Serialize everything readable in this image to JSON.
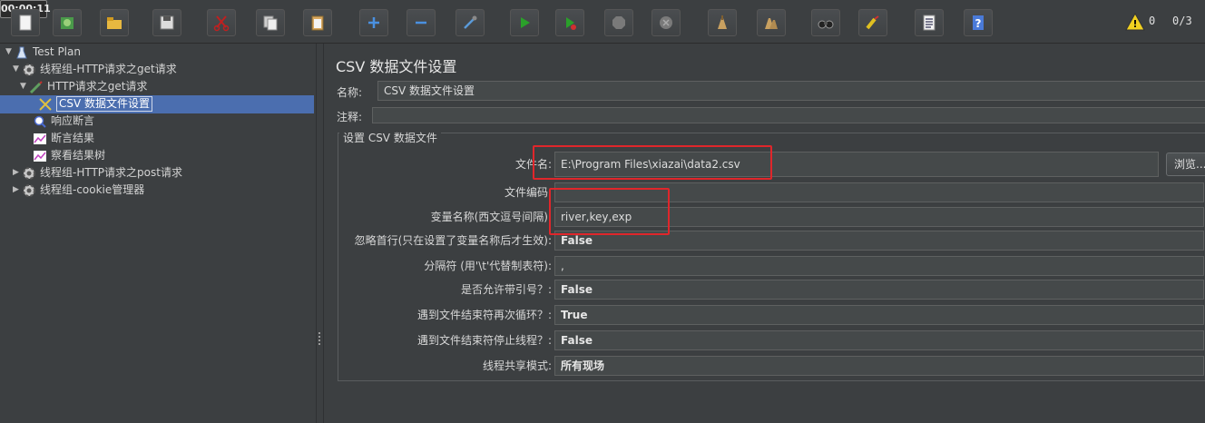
{
  "toolbar": {
    "buttons": [
      {
        "name": "new-icon"
      },
      {
        "name": "templates-icon"
      },
      {
        "name": "open-icon"
      },
      {
        "name": "save-icon"
      },
      {
        "name": "cut-icon"
      },
      {
        "name": "copy-icon"
      },
      {
        "name": "paste-icon"
      },
      {
        "name": "expand-icon"
      },
      {
        "name": "collapse-icon"
      },
      {
        "name": "toggle-icon"
      },
      {
        "name": "start-icon"
      },
      {
        "name": "start-no-pause-icon"
      },
      {
        "name": "stop-icon"
      },
      {
        "name": "shutdown-icon"
      },
      {
        "name": "clear-icon"
      },
      {
        "name": "clear-all-icon"
      },
      {
        "name": "search-icon"
      },
      {
        "name": "reset-search-icon"
      },
      {
        "name": "function-helper-icon"
      },
      {
        "name": "help-icon"
      }
    ],
    "timer": "00:00:11",
    "warning_count": "0",
    "threads": "0/3"
  },
  "tree": {
    "nodes": [
      {
        "label": "Test Plan",
        "icon": "test-plan-icon"
      },
      {
        "label": "线程组-HTTP请求之get请求",
        "icon": "thread-group-icon"
      },
      {
        "label": "HTTP请求之get请求",
        "icon": "http-sampler-icon"
      },
      {
        "label": "CSV 数据文件设置",
        "icon": "csv-config-icon"
      },
      {
        "label": "响应断言",
        "icon": "assertion-icon"
      },
      {
        "label": "断言结果",
        "icon": "listener-icon"
      },
      {
        "label": "察看结果树",
        "icon": "listener-icon"
      },
      {
        "label": "线程组-HTTP请求之post请求",
        "icon": "thread-group-icon"
      },
      {
        "label": "线程组-cookie管理器",
        "icon": "thread-group-icon"
      }
    ]
  },
  "panel": {
    "title": "CSV 数据文件设置",
    "name_label": "名称:",
    "name_value": "CSV 数据文件设置",
    "comment_label": "注释:",
    "comment_value": "",
    "group_title": "设置 CSV 数据文件",
    "filename_label": "文件名:",
    "filename_value": "E:\\Program Files\\xiazai\\data2.csv",
    "browse_label": "浏览...",
    "encoding_label": "文件编码:",
    "encoding_value": "",
    "varnames_label": "变量名称(西文逗号间隔):",
    "varnames_value": "river,key,exp",
    "ignore_header_label": "忽略首行(只在设置了变量名称后才生效):",
    "ignore_header_value": "False",
    "delimiter_label": "分隔符 (用'\\t'代替制表符):",
    "delimiter_value": ",",
    "quoted_label": "是否允许带引号？:",
    "quoted_value": "False",
    "recycle_label": "遇到文件结束符再次循环？:",
    "recycle_value": "True",
    "stop_thread_label": "遇到文件结束符停止线程？:",
    "stop_thread_value": "False",
    "sharing_label": "线程共享模式:",
    "sharing_value": "所有现场"
  },
  "colors": {
    "background": "#3c3f41",
    "selection": "#4b6eaf",
    "highlight_box": "#e0262b"
  }
}
